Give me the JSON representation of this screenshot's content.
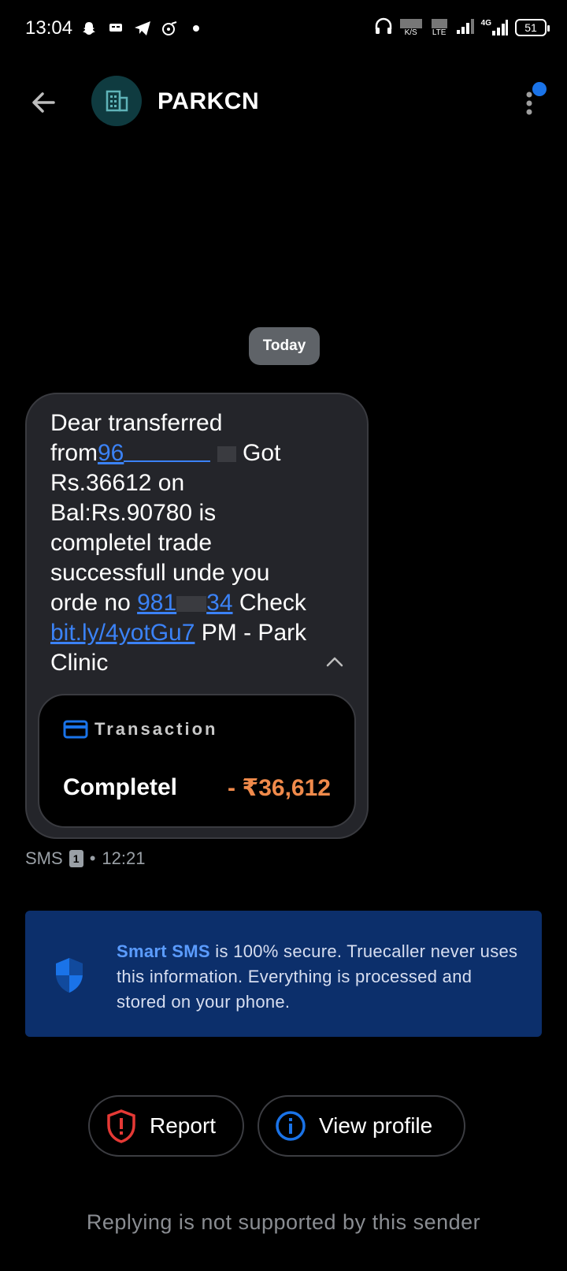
{
  "status_bar": {
    "time": "13:04",
    "net_speed_unit": "K/S",
    "network_type": "LTE",
    "signal_label": "4G",
    "battery": "51"
  },
  "header": {
    "sender": "PARKCN",
    "avatar_icon": "building-icon"
  },
  "date_chip": "Today",
  "message": {
    "line1": "Dear transferred",
    "line2_prefix": "from",
    "line2_link": "96",
    "line2_suffix": " Got",
    "line3": "Rs.36612 on",
    "line4": "Bal:Rs.90780 is",
    "line5": "completel trade",
    "line6": "successfull unde you",
    "line7_prefix": "orde no ",
    "line7_link_start": "981",
    "line7_link_end": "34",
    "line7_suffix": " Check",
    "line8_link": "bit.ly/4yotGu7",
    "line8_suffix": " PM - Park",
    "line9": "Clinic",
    "transaction": {
      "label": "Transaction",
      "status": "Completel",
      "amount": "- ₹36,612",
      "amount_color": "#f08a4b"
    },
    "meta": {
      "type": "SMS",
      "sim": "1",
      "separator": "•",
      "time": "12:21"
    }
  },
  "banner": {
    "highlight": "Smart SMS",
    "text": " is 100% secure. Truecaller never uses this information. Everything is processed and stored on your phone."
  },
  "actions": {
    "report_label": "Report",
    "profile_label": "View profile"
  },
  "footer_note": "Replying is not supported by this sender",
  "colors": {
    "accent": "#1a73e8",
    "banner_bg": "#0c2f6b",
    "report_red": "#e53935"
  }
}
